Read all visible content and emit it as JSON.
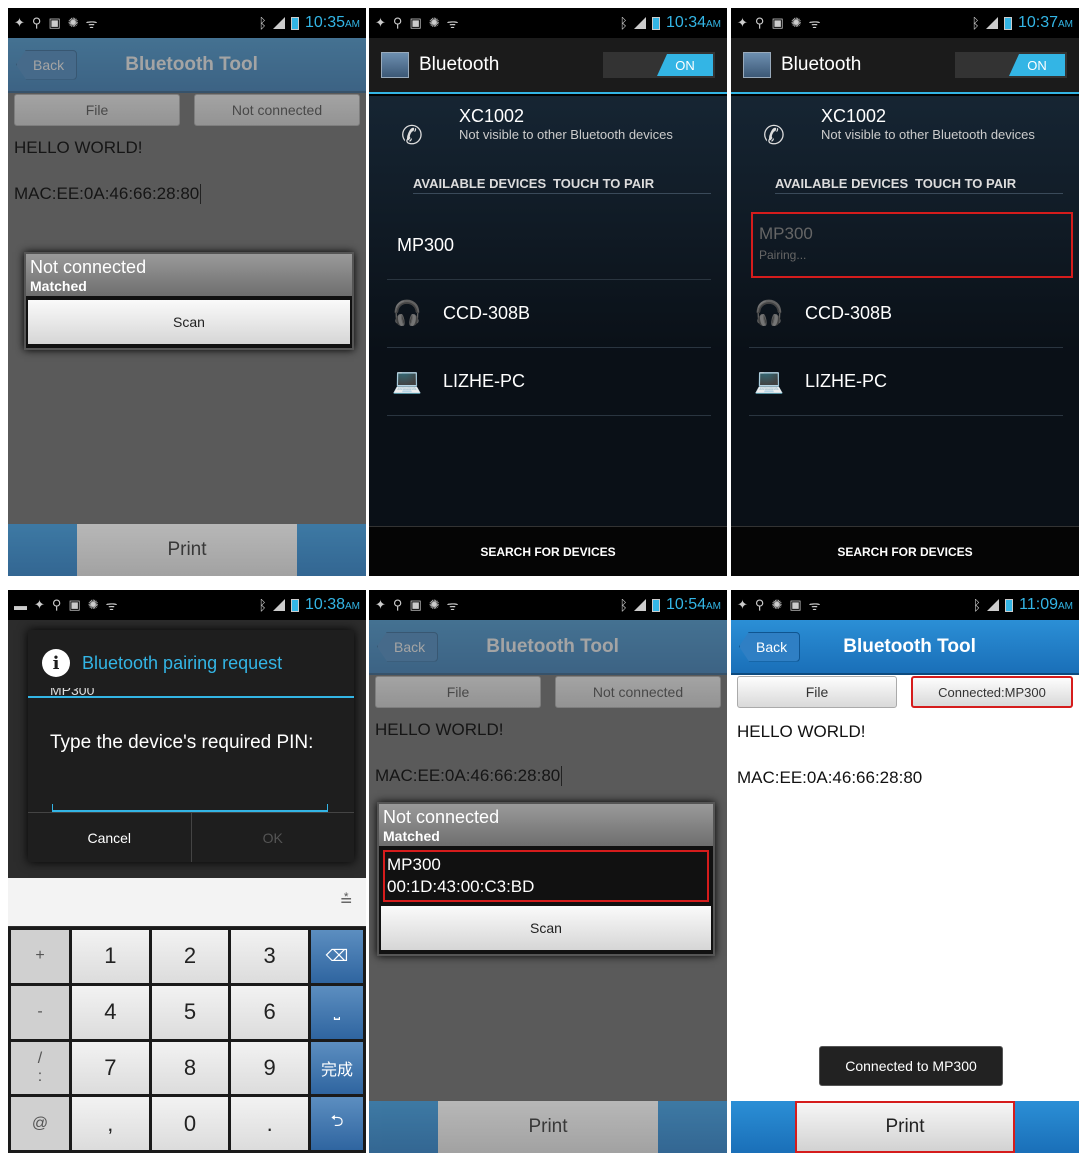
{
  "colors": {
    "accent": "#33b5e5",
    "app_blue": "#1a6fb8",
    "highlight_red": "#d51c1c"
  },
  "panel1": {
    "status_time": "10:35",
    "status_ampm": "AM",
    "back_label": "Back",
    "title": "Bluetooth Tool",
    "file_button": "File",
    "connection_button": "Not connected",
    "line1": "HELLO WORLD!",
    "line2": "MAC:EE:0A:46:66:28:80",
    "popup_title": "Not connected",
    "popup_subtitle": "Matched",
    "scan_button": "Scan",
    "print_button": "Print"
  },
  "panel2": {
    "status_time": "10:34",
    "status_ampm": "AM",
    "title": "Bluetooth",
    "toggle": "ON",
    "self_name": "XC1002",
    "self_sub": "Not visible to other Bluetooth devices",
    "section_left": "AVAILABLE DEVICES",
    "section_right": "TOUCH TO PAIR",
    "dev1": "MP300",
    "dev2": "CCD-308B",
    "dev3": "LIZHE-PC",
    "search": "SEARCH FOR DEVICES"
  },
  "panel3": {
    "status_time": "10:37",
    "status_ampm": "AM",
    "title": "Bluetooth",
    "toggle": "ON",
    "self_name": "XC1002",
    "self_sub": "Not visible to other Bluetooth devices",
    "section_left": "AVAILABLE DEVICES",
    "section_right": "TOUCH TO PAIR",
    "dev1": "MP300",
    "dev1_sub": "Pairing...",
    "dev2": "CCD-308B",
    "dev3": "LIZHE-PC",
    "search": "SEARCH FOR DEVICES"
  },
  "panel4": {
    "status_time": "10:38",
    "status_ampm": "AM",
    "dialog_title": "Bluetooth pairing request",
    "dialog_device": "MP300",
    "prompt": "Type the device's required PIN:",
    "cancel": "Cancel",
    "ok": "OK",
    "keys": {
      "k_plus": "+",
      "k_minus": "-",
      "k_slash": "/",
      "k_colon": ":",
      "k_at": "@",
      "k1": "1",
      "k2": "2",
      "k3": "3",
      "k4": "4",
      "k5": "5",
      "k6": "6",
      "k7": "7",
      "k8": "8",
      "k9": "9",
      "k_comma": ",",
      "k0": "0",
      "k_dot": ".",
      "k_done": "完成"
    }
  },
  "panel5": {
    "status_time": "10:54",
    "status_ampm": "AM",
    "back_label": "Back",
    "title": "Bluetooth Tool",
    "file_button": "File",
    "connection_button": "Not connected",
    "line1": "HELLO WORLD!",
    "line2": "MAC:EE:0A:46:66:28:80",
    "popup_title": "Not connected",
    "popup_subtitle": "Matched",
    "device_name": "MP300",
    "device_mac": "00:1D:43:00:C3:BD",
    "scan_button": "Scan",
    "print_button": "Print"
  },
  "panel6": {
    "status_time": "11:09",
    "status_ampm": "AM",
    "back_label": "Back",
    "title": "Bluetooth Tool",
    "file_button": "File",
    "connection_button": "Connected:MP300",
    "line1": "HELLO WORLD!",
    "line2": "MAC:EE:0A:46:66:28:80",
    "toast": "Connected to MP300",
    "print_button": "Print"
  }
}
